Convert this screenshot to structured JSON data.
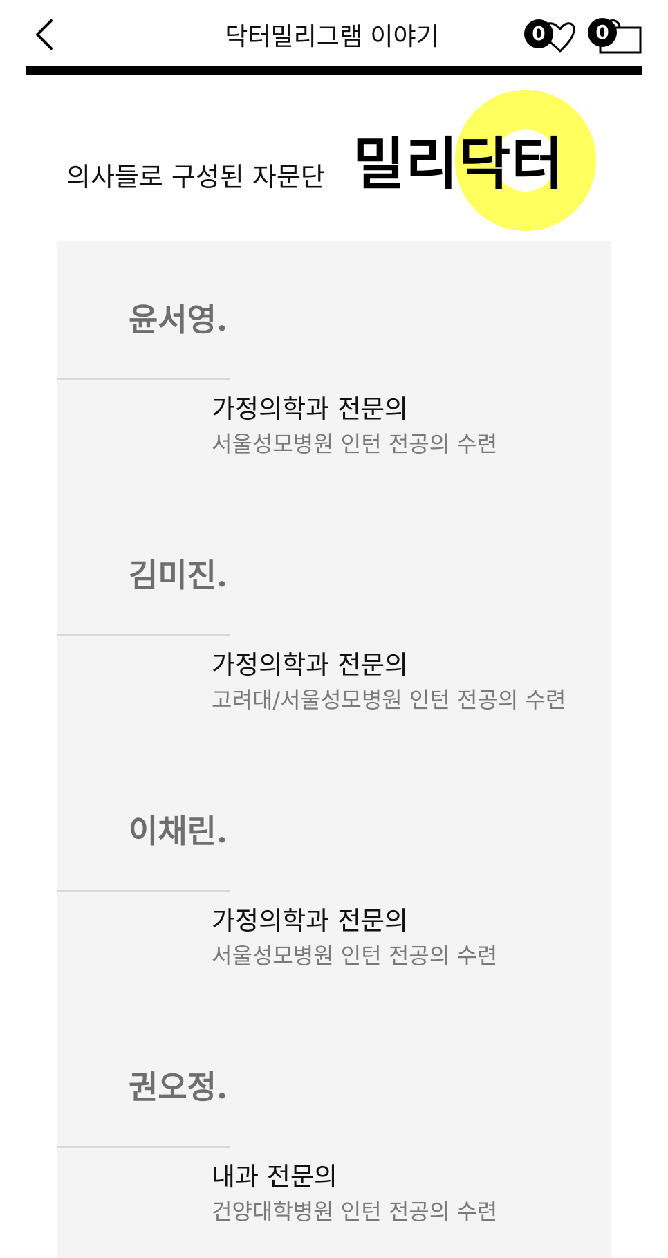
{
  "header": {
    "title": "닥터밀리그램 이야기",
    "wishlist_count": "0",
    "cart_count": "0"
  },
  "hero": {
    "subtitle": "의사들로 구성된 자문단",
    "brand": "밀리닥터",
    "accent_color": "#ffff5e"
  },
  "doctors": [
    {
      "name": "윤서영.",
      "specialty": "가정의학과 전문의",
      "training": "서울성모병원 인턴 전공의 수련"
    },
    {
      "name": "김미진.",
      "specialty": "가정의학과 전문의",
      "training": "고려대/서울성모병원 인턴 전공의 수련"
    },
    {
      "name": "이채린.",
      "specialty": "가정의학과 전문의",
      "training": "서울성모병원 인턴 전공의 수련"
    },
    {
      "name": "권오정.",
      "specialty": "내과 전문의",
      "training": "건양대학병원 인턴 전공의 수련"
    }
  ]
}
